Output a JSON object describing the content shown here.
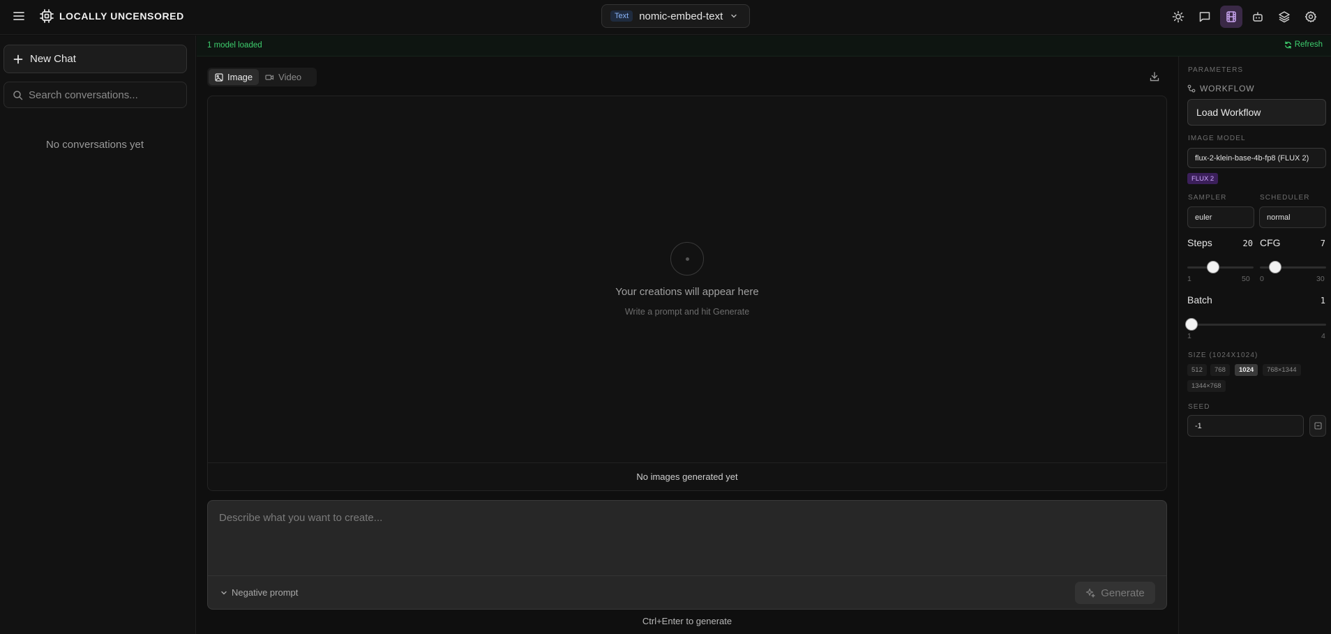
{
  "topbar": {
    "brand": "LOCALLY UNCENSORED",
    "model_badge": "Text",
    "model_name": "nomic-embed-text",
    "icons": [
      "sun-icon",
      "chat-icon",
      "film-icon",
      "robot-icon",
      "layers-icon",
      "gear-icon"
    ],
    "accent_active": "#3a2946"
  },
  "sidebar": {
    "new_chat_label": "New Chat",
    "search_placeholder": "Search conversations...",
    "empty_text": "No conversations yet"
  },
  "status": {
    "text": "1 model loaded",
    "refresh_label": "Refresh",
    "color": "#3ecf6e"
  },
  "main": {
    "tabs": [
      {
        "label": "Image",
        "active": true
      },
      {
        "label": "Video",
        "active": false
      }
    ],
    "empty_title": "Your creations will appear here",
    "empty_sub": "Write a prompt and hit Generate",
    "gallery_footer": "No images generated yet",
    "prompt_placeholder": "Describe what you want to create...",
    "negative_prompt_label": "Negative prompt",
    "generate_label": "Generate",
    "hint": "Ctrl+Enter to generate"
  },
  "params": {
    "header": "PARAMETERS",
    "workflow_label": "WORKFLOW",
    "load_workflow_label": "Load Workflow",
    "image_model_label": "IMAGE MODEL",
    "image_model_value": "flux-2-klein-base-4b-fp8 (FLUX 2)",
    "model_badge": "FLUX 2",
    "sampler_label": "SAMPLER",
    "sampler_value": "euler",
    "scheduler_label": "SCHEDULER",
    "scheduler_value": "normal",
    "steps": {
      "label": "Steps",
      "value": "20",
      "min": "1",
      "max": "50",
      "fraction": 0.388
    },
    "cfg": {
      "label": "CFG",
      "value": "7",
      "min": "0",
      "max": "30",
      "fraction": 0.233
    },
    "batch": {
      "label": "Batch",
      "value": "1",
      "min": "1",
      "max": "4",
      "fraction": 0.0
    },
    "size_label": "SIZE (1024X1024)",
    "sizes": [
      {
        "label": "512",
        "active": false
      },
      {
        "label": "768",
        "active": false
      },
      {
        "label": "1024",
        "active": true
      },
      {
        "label": "768×1344",
        "active": false
      },
      {
        "label": "1344×768",
        "active": false
      }
    ],
    "seed_label": "SEED",
    "seed_value": "-1"
  }
}
